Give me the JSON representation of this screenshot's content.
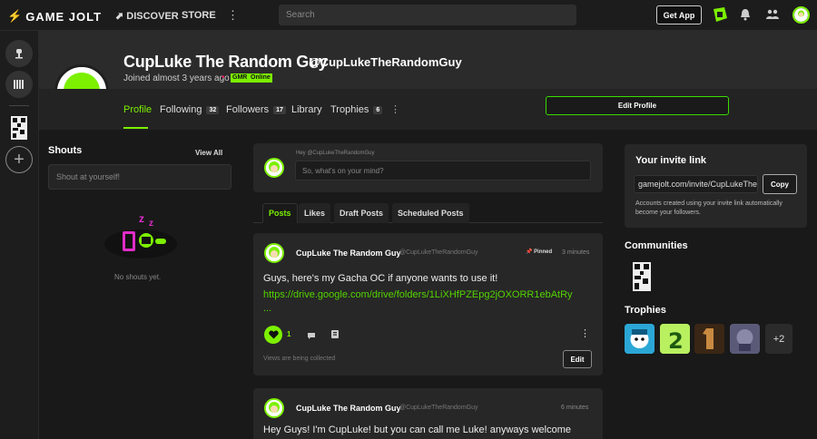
{
  "topbar": {
    "logo_text": "GAME JOLT",
    "discover_label": "DISCOVER",
    "store_label": "STORE",
    "more_glyph": "⋮",
    "search_placeholder": "Search",
    "get_app_label": "Get App",
    "icons": [
      "quest-icon",
      "bell-icon",
      "friends-icon",
      "user-avatar"
    ]
  },
  "rail": {
    "add_glyph": "+"
  },
  "profile": {
    "display_name": "CupLuke The Random Guy",
    "username": "@CupLukeTheRandomGuy",
    "joined": "Joined almost 3 years ago",
    "badges": [
      "GMR",
      "Online"
    ],
    "tabs": [
      {
        "label": "Profile"
      },
      {
        "label": "Following",
        "count": "32"
      },
      {
        "label": "Followers",
        "count": "17"
      },
      {
        "label": "Library"
      },
      {
        "label": "Trophies",
        "count": "6"
      }
    ],
    "more_glyph": "⋮",
    "edit_profile_label": "Edit Profile"
  },
  "shouts": {
    "title": "Shouts",
    "view_all_label": "View All",
    "input_placeholder": "Shout at yourself!",
    "empty_text": "No shouts yet."
  },
  "composer": {
    "hey_text": "Hey @CupLukeTheRandomGuy",
    "placeholder": "So, what's on your mind?"
  },
  "post_tabs": [
    "Posts",
    "Likes",
    "Draft Posts",
    "Scheduled Posts"
  ],
  "posts": [
    {
      "name": "CupLuke The Random Guy",
      "handle": "@CupLukeTheRandomGuy",
      "pinned": "Pinned",
      "time": "3 minutes",
      "text": "Guys, here's my Gacha OC if anyone wants to use it!",
      "link": "https://drive.google.com/drive/folders/1LiXHfPZEpg2jOXORR1ebAtRy",
      "ellipsis": "...",
      "likes": "1",
      "views_note": "Views are being collected",
      "edit_label": "Edit",
      "more_glyph": "⋮"
    },
    {
      "name": "CupLuke The Random Guy",
      "handle": "@CupLukeTheRandomGuy",
      "time": "6 minutes",
      "text": "Hey Guys! I'm CupLuke! but you can call me Luke! anyways welcome"
    }
  ],
  "invite": {
    "title": "Your invite link",
    "url": "gamejolt.com/invite/CupLukeTheRandomGuy",
    "copy_label": "Copy",
    "note": "Accounts created using your invite link automatically become your followers."
  },
  "communities": {
    "title": "Communities"
  },
  "trophies": {
    "title": "Trophies",
    "more_label": "+2"
  },
  "colors": {
    "accent": "#7cf000",
    "background": "#191919",
    "panel": "#272727"
  }
}
